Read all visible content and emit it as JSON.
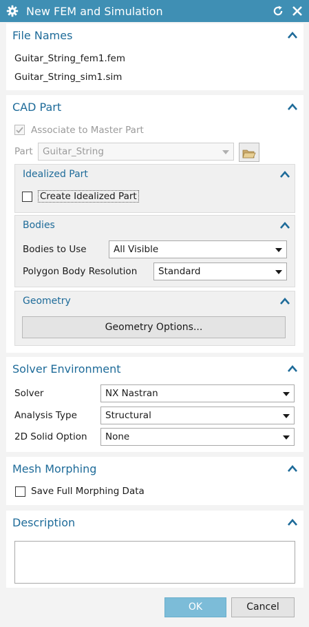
{
  "window": {
    "title": "New FEM and Simulation"
  },
  "icons": {
    "settings": "gear-icon",
    "reset": "reset-icon",
    "close": "close-icon",
    "collapse": "chevron-up-icon",
    "folder": "folder-open-icon"
  },
  "file_names": {
    "title": "File Names",
    "fem_file": "Guitar_String_fem1.fem",
    "sim_file": "Guitar_String_sim1.sim"
  },
  "cad_part": {
    "title": "CAD Part",
    "associate_label": "Associate to Master Part",
    "associate_checked": true,
    "part_label": "Part",
    "part_value": "Guitar_String",
    "idealized": {
      "title": "Idealized Part",
      "create_label": "Create Idealized Part",
      "create_checked": false
    },
    "bodies": {
      "title": "Bodies",
      "bodies_to_use_label": "Bodies to Use",
      "bodies_to_use_value": "All Visible",
      "polygon_label": "Polygon Body Resolution",
      "polygon_value": "Standard"
    },
    "geometry": {
      "title": "Geometry",
      "options_button": "Geometry Options..."
    }
  },
  "solver_env": {
    "title": "Solver Environment",
    "solver_label": "Solver",
    "solver_value": "NX Nastran",
    "analysis_label": "Analysis Type",
    "analysis_value": "Structural",
    "solid_label": "2D Solid Option",
    "solid_value": "None"
  },
  "mesh_morphing": {
    "title": "Mesh Morphing",
    "save_label": "Save Full Morphing Data",
    "save_checked": false
  },
  "description": {
    "title": "Description",
    "value": ""
  },
  "footer": {
    "ok_label": "OK",
    "cancel_label": "Cancel"
  },
  "colors": {
    "titlebar": "#3f8fb4",
    "section_title": "#1e6b99",
    "ok_button": "#7cbcd8"
  }
}
